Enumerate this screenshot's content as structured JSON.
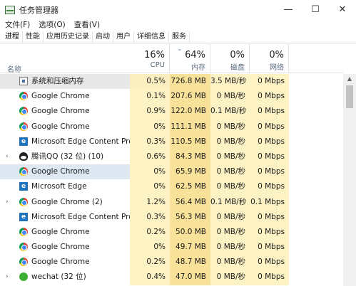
{
  "window": {
    "title": "任务管理器",
    "controls": {
      "minimize": "—",
      "maximize": "☐",
      "close": "✕"
    }
  },
  "menu": [
    "文件(F)",
    "选项(O)",
    "查看(V)"
  ],
  "tabs": [
    "进程",
    "性能",
    "应用历史记录",
    "启动",
    "用户",
    "详细信息",
    "服务"
  ],
  "columns": {
    "name": "名称",
    "cpu": {
      "pct": "16%",
      "label": "CPU"
    },
    "memory": {
      "pct": "64%",
      "label": "内存"
    },
    "disk": {
      "pct": "0%",
      "label": "磁盘"
    },
    "network": {
      "pct": "0%",
      "label": "网络"
    }
  },
  "processes": [
    {
      "name": "系统和压缩内存",
      "icon": "system-icon",
      "expand": "",
      "cpu": "0.5%",
      "mem": "726.8 MB",
      "disk": "3.5 MB/秒",
      "net": "0 Mbps"
    },
    {
      "name": "Google Chrome",
      "icon": "chrome-icon",
      "expand": "",
      "cpu": "0.1%",
      "mem": "207.6 MB",
      "disk": "0 MB/秒",
      "net": "0 Mbps"
    },
    {
      "name": "Google Chrome",
      "icon": "chrome-icon",
      "expand": "",
      "cpu": "0.9%",
      "mem": "122.0 MB",
      "disk": "0.1 MB/秒",
      "net": "0 Mbps"
    },
    {
      "name": "Google Chrome",
      "icon": "chrome-icon",
      "expand": "",
      "cpu": "0%",
      "mem": "111.1 MB",
      "disk": "0 MB/秒",
      "net": "0 Mbps"
    },
    {
      "name": "Microsoft Edge Content Pro...",
      "icon": "edge-icon",
      "expand": "",
      "cpu": "0.3%",
      "mem": "110.5 MB",
      "disk": "0 MB/秒",
      "net": "0 Mbps"
    },
    {
      "name": "腾讯QQ (32 位) (10)",
      "icon": "qq-icon",
      "expand": "›",
      "cpu": "0.6%",
      "mem": "84.3 MB",
      "disk": "0 MB/秒",
      "net": "0 Mbps"
    },
    {
      "name": "Google Chrome",
      "icon": "chrome-icon",
      "expand": "",
      "cpu": "0%",
      "mem": "65.9 MB",
      "disk": "0 MB/秒",
      "net": "0 Mbps"
    },
    {
      "name": "Microsoft Edge",
      "icon": "edge-icon",
      "expand": "",
      "cpu": "0%",
      "mem": "62.5 MB",
      "disk": "0 MB/秒",
      "net": "0 Mbps"
    },
    {
      "name": "Google Chrome (2)",
      "icon": "chrome-icon",
      "expand": "›",
      "cpu": "1.2%",
      "mem": "56.4 MB",
      "disk": "0.1 MB/秒",
      "net": "0.1 Mbps"
    },
    {
      "name": "Microsoft Edge Content Pro...",
      "icon": "edge-icon",
      "expand": "",
      "cpu": "0.3%",
      "mem": "56.3 MB",
      "disk": "0 MB/秒",
      "net": "0 Mbps"
    },
    {
      "name": "Google Chrome",
      "icon": "chrome-icon",
      "expand": "",
      "cpu": "0.2%",
      "mem": "50.0 MB",
      "disk": "0 MB/秒",
      "net": "0 Mbps"
    },
    {
      "name": "Google Chrome",
      "icon": "chrome-icon",
      "expand": "",
      "cpu": "0%",
      "mem": "49.7 MB",
      "disk": "0 MB/秒",
      "net": "0 Mbps"
    },
    {
      "name": "Google Chrome",
      "icon": "chrome-icon",
      "expand": "",
      "cpu": "0.2%",
      "mem": "48.7 MB",
      "disk": "0 MB/秒",
      "net": "0 Mbps"
    },
    {
      "name": "wechat (32 位)",
      "icon": "wechat-icon",
      "expand": "›",
      "cpu": "0.4%",
      "mem": "47.0 MB",
      "disk": "0 MB/秒",
      "net": "0 Mbps"
    }
  ],
  "selected_row": 6,
  "colors": {
    "cpu_bg": "#fdf2c4",
    "mem_bg": "#f8e29a",
    "selected_bg": "#dde8f3",
    "header_label": "#5a6b80"
  }
}
